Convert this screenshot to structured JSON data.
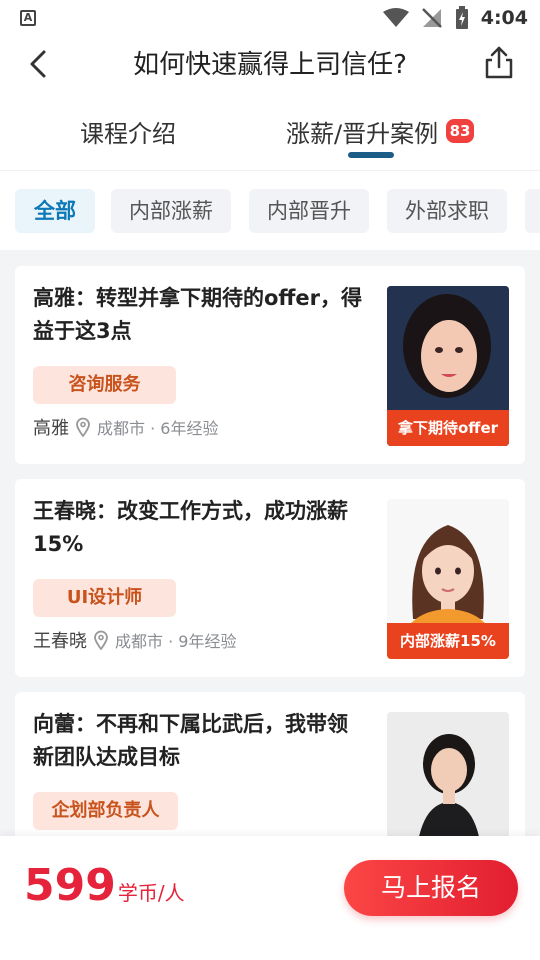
{
  "status_bar": {
    "time": "4:04",
    "app_letter": "A"
  },
  "header": {
    "title": "如何快速赢得上司信任?"
  },
  "tabs": [
    {
      "label": "课程介绍",
      "active": false
    },
    {
      "label": "涨薪/晋升案例",
      "active": true,
      "badge": "83"
    }
  ],
  "filters": [
    "全部",
    "内部涨薪",
    "内部晋升",
    "外部求职"
  ],
  "cards": [
    {
      "title": "高雅：转型并拿下期待的offer，得益于这3点",
      "tag": "咨询服务",
      "name": "高雅",
      "location": "成都市 · 6年经验",
      "ribbon": "拿下期待offer"
    },
    {
      "title": "王春晓：改变工作方式，成功涨薪15%",
      "tag": "UI设计师",
      "name": "王春晓",
      "location": "成都市 · 9年经验",
      "ribbon": "内部涨薪15%"
    },
    {
      "title": "向蕾：不再和下属比武后，我带领新团队达成目标",
      "tag": "企划部负责人",
      "name": "",
      "location": "",
      "ribbon": ""
    }
  ],
  "bottom": {
    "price": "599",
    "price_unit": "学币/人",
    "enroll_label": "马上报名"
  },
  "colors": {
    "accent_blue": "#0d78b6",
    "tab_indicator": "#1b5d86",
    "badge_red": "#f0413e",
    "price_red": "#e5233a",
    "ribbon_orange": "#e8421e"
  }
}
